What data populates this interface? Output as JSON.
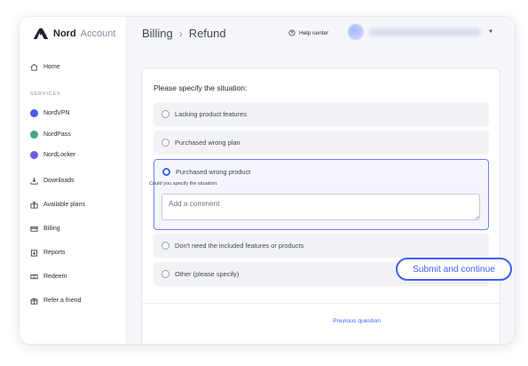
{
  "app": {
    "brand": "Nord",
    "sub": "Account"
  },
  "sidebar": {
    "home": "Home",
    "section_label": "SERVICES",
    "items": [
      {
        "label": "NordVPN",
        "icon": "nordvpn-icon",
        "color": "#4a5cf0"
      },
      {
        "label": "NordPass",
        "icon": "nordpass-icon",
        "color": "#3ea889"
      },
      {
        "label": "NordLocker",
        "icon": "nordlocker-icon",
        "color": "#6c5ce7"
      }
    ],
    "links": [
      {
        "label": "Downloads",
        "icon": "download-icon"
      },
      {
        "label": "Available plans",
        "icon": "gift-icon"
      },
      {
        "label": "Billing",
        "icon": "card-icon"
      },
      {
        "label": "Reports",
        "icon": "report-icon"
      },
      {
        "label": "Redeem",
        "icon": "ticket-icon"
      },
      {
        "label": "Refer a friend",
        "icon": "present-icon"
      }
    ]
  },
  "header": {
    "crumb_parent": "Billing",
    "crumb_current": "Refund",
    "help": "Help center"
  },
  "form": {
    "question": "Please specify the situation:",
    "options": [
      "Lacking product features",
      "Purchased wrong plan",
      "Purchased wrong product",
      "Don't need the included features or products",
      "Other (please specify)"
    ],
    "selected_index": 2,
    "specify_label": "Could you specify the situation:",
    "comment_placeholder": "Add a comment"
  },
  "actions": {
    "previous": "Previous question",
    "submit": "Submit and continue"
  },
  "colors": {
    "accent": "#3e5fff",
    "bg": "#f6f7fa"
  }
}
